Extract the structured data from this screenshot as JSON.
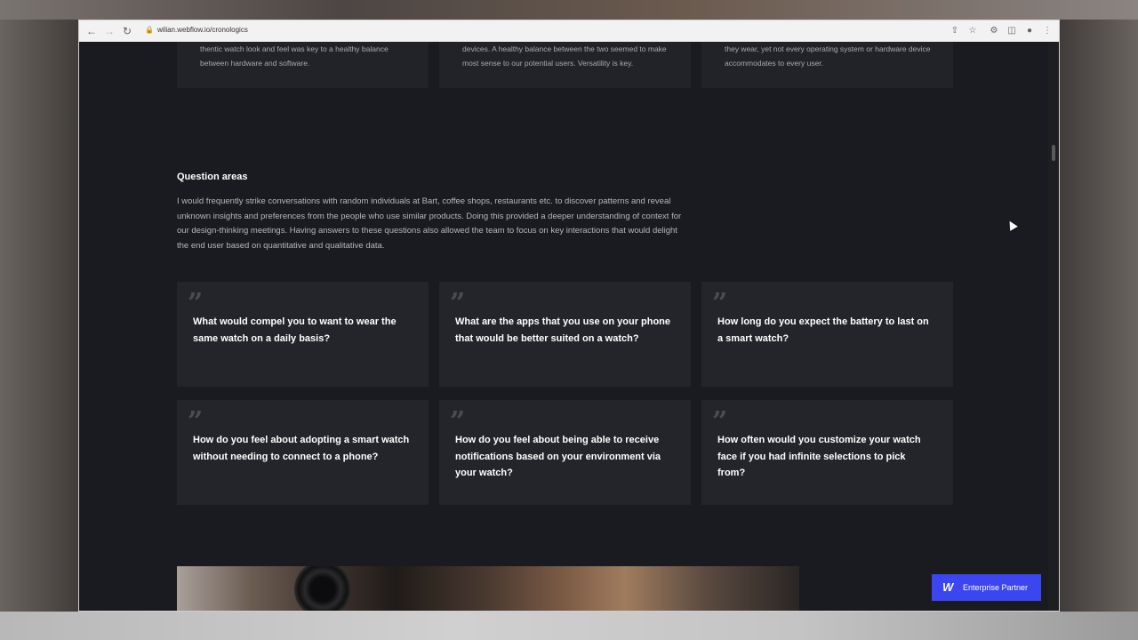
{
  "browser": {
    "url": "wilian.webflow.io/cronologics"
  },
  "top_cards": [
    {
      "text": "thentic watch look and feel was key to a healthy balance between hardware and software."
    },
    {
      "text": "devices. A healthy balance between the two seemed to make most sense to our potential users. Versatility is key."
    },
    {
      "text": "they wear, yet not every operating system or hardware device accommodates to every user."
    }
  ],
  "section": {
    "title": "Question areas",
    "body": "I would frequently strike conversations with random individuals at Bart, coffee shops, restaurants etc. to discover patterns and reveal unknown insights and preferences from the people who use similar products. Doing this provided a deeper understanding of context for our design-thinking meetings. Having answers to these questions also allowed the team to focus on key interactions that would delight the end user based on quantitative and qualitative data."
  },
  "questions": [
    {
      "mark": "”",
      "text": "What would compel you to want to wear the same watch on a daily basis?"
    },
    {
      "mark": "”",
      "text": "What are the apps that you use on your phone that would be better suited on a watch?"
    },
    {
      "mark": "”",
      "text": "How long do you expect the battery to last on a smart watch?"
    },
    {
      "mark": "”",
      "text": "How do you feel about adopting a smart watch without needing to connect to a phone?"
    },
    {
      "mark": "”",
      "text": "How do you feel about being able to receive notifications based on your environment via your watch?"
    },
    {
      "mark": "”",
      "text": "How often would you customize your watch face if you had infinite selections to pick from?"
    }
  ],
  "badge": {
    "logo": "W",
    "label": "Enterprise Partner"
  },
  "colors": {
    "page_bg": "#1a1b20",
    "card_bg": "#24252b",
    "accent": "#3b46f0"
  }
}
